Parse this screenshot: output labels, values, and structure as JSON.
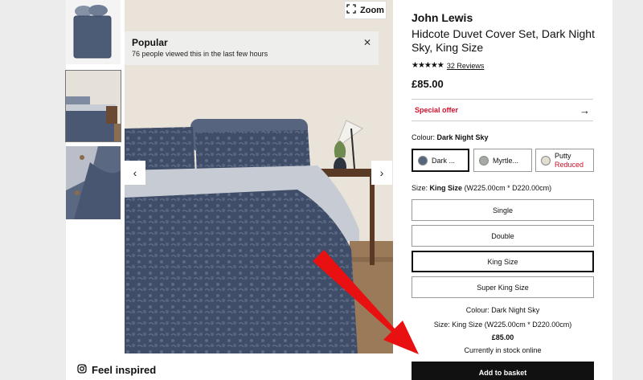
{
  "gallery": {
    "zoom_label": "Zoom",
    "popular_title": "Popular",
    "popular_subtitle": "76 people viewed this in the last few hours",
    "feel_inspired": "Feel inspired"
  },
  "product": {
    "brand": "John Lewis",
    "title": "Hidcote Duvet Cover Set, Dark Night Sky, King Size",
    "rating_stars": "★★★★★",
    "reviews": "32 Reviews",
    "price": "£85.00",
    "special_offer": "Special offer"
  },
  "colour": {
    "label": "Colour:",
    "selected": "Dark Night Sky",
    "options": [
      {
        "label": "Dark ...",
        "color": "#56657e"
      },
      {
        "label": "Myrtle...",
        "color": "#a6aaa4"
      },
      {
        "label": "Putty",
        "note": "Reduced",
        "color": "#e2ded0"
      }
    ]
  },
  "size": {
    "label": "Size:",
    "selected": "King Size",
    "dims": "(W225.00cm * D220.00cm)",
    "options": [
      "Single",
      "Double",
      "King Size",
      "Super King Size"
    ]
  },
  "summary": {
    "colour": "Colour: Dark Night Sky",
    "size": "Size: King Size (W225.00cm * D220.00cm)",
    "price": "£85.00",
    "stock": "Currently in stock online"
  },
  "cta": {
    "add_to_basket": "Add to basket"
  },
  "annotation_color": "#e81010"
}
